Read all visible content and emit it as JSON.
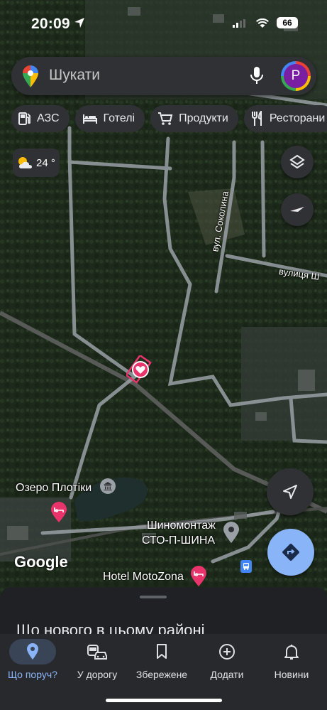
{
  "status": {
    "time": "20:09",
    "battery": "66"
  },
  "search": {
    "placeholder": "Шукати",
    "avatar_letter": "P"
  },
  "chips": [
    {
      "icon": "gas-station-icon",
      "label": "АЗС"
    },
    {
      "icon": "bed-icon",
      "label": "Готелі"
    },
    {
      "icon": "cart-icon",
      "label": "Продукти"
    },
    {
      "icon": "fork-knife-icon",
      "label": "Ресторани"
    }
  ],
  "weather": {
    "icon": "partly-cloudy-icon",
    "temp": "24 °"
  },
  "map": {
    "streets": {
      "sokolyna": "вул. Соколина",
      "vulytsia": "вулиця Ш"
    },
    "pois": {
      "lake": "Озеро Плотіки",
      "tire_shop_1": "Шиномонтаж",
      "tire_shop_2": "СТО-П-ШИНА",
      "hotel": "Hotel MotoZona"
    },
    "saved_marker_color": "#e8336b",
    "attribution": "Google"
  },
  "sheet": {
    "heading": "Що нового в цьому районі"
  },
  "nav": [
    {
      "icon": "location-pin-icon",
      "label": "Що поруч?",
      "active": true
    },
    {
      "icon": "commute-icon",
      "label": "У дорогу",
      "active": false
    },
    {
      "icon": "bookmark-icon",
      "label": "Збережене",
      "active": false
    },
    {
      "icon": "add-circle-icon",
      "label": "Додати",
      "active": false
    },
    {
      "icon": "bell-icon",
      "label": "Новини",
      "active": false
    }
  ],
  "colors": {
    "surface": "#303134",
    "accent": "#8ab4f8",
    "active_pill": "#394457"
  }
}
